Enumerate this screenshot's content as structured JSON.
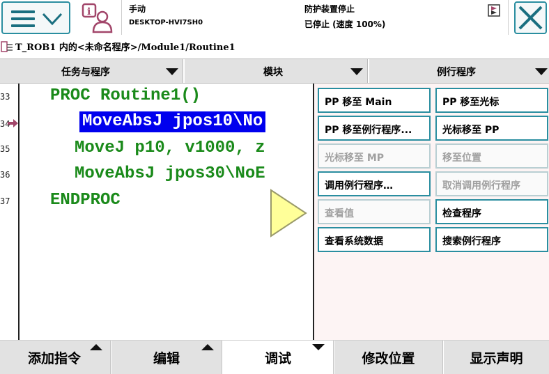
{
  "header": {
    "mode_label": "手动",
    "controller_name": "DESKTOP-HVI7SH0",
    "safety_status": "防护装置停止",
    "run_status": "已停止 (速度 100%)"
  },
  "path": {
    "text": "T_ROB1 内的<未命名程序>/Module1/Routine1"
  },
  "tabs": [
    {
      "label": "任务与程序"
    },
    {
      "label": "模块"
    },
    {
      "label": "例行程序"
    }
  ],
  "editor": {
    "lines": [
      {
        "number": "33",
        "code": "PROC Routine1()"
      },
      {
        "number": "34",
        "code": "MoveAbsJ jpos10\\No"
      },
      {
        "number": "35",
        "code": "MoveJ p10, v1000, z"
      },
      {
        "number": "36",
        "code": "MoveAbsJ jpos30\\NoE"
      },
      {
        "number": "37",
        "code": "ENDPROC"
      }
    ]
  },
  "popup_menu": {
    "items": [
      {
        "label": "PP 移至 Main",
        "enabled": true
      },
      {
        "label": "PP 移至光标",
        "enabled": true
      },
      {
        "label": "PP 移至例行程序...",
        "enabled": true
      },
      {
        "label": "光标移至 PP",
        "enabled": true
      },
      {
        "label": "光标移至 MP",
        "enabled": false
      },
      {
        "label": "移至位置",
        "enabled": false
      },
      {
        "label": "调用例行程序…",
        "enabled": true
      },
      {
        "label": "取消调用例行程序",
        "enabled": false
      },
      {
        "label": "查看值",
        "enabled": false
      },
      {
        "label": "检查程序",
        "enabled": true
      },
      {
        "label": "查看系统数据",
        "enabled": true
      },
      {
        "label": "搜索例行程序",
        "enabled": true
      }
    ]
  },
  "bottom_bar": {
    "buttons": [
      {
        "label": "添加指令"
      },
      {
        "label": "编辑"
      },
      {
        "label": "调试"
      },
      {
        "label": "修改位置"
      },
      {
        "label": "显示声明"
      }
    ]
  },
  "colors": {
    "accent": "#2a8ea0",
    "code_green": "#1a8a1a",
    "selection_blue": "#0000ee",
    "popup_bg": "#fdf4f4",
    "bar_gray": "#e2e2e2",
    "play_yellow": "#ffff99"
  },
  "icons": {
    "menu": "hamburger-icon",
    "menu_expand": "chevron-down-icon",
    "status": "info-person-icon",
    "close": "close-icon",
    "status_flag": "flag-icon",
    "program_path": "program-icon",
    "program_pointer": "pp-arrow-icon",
    "play": "play-icon"
  }
}
